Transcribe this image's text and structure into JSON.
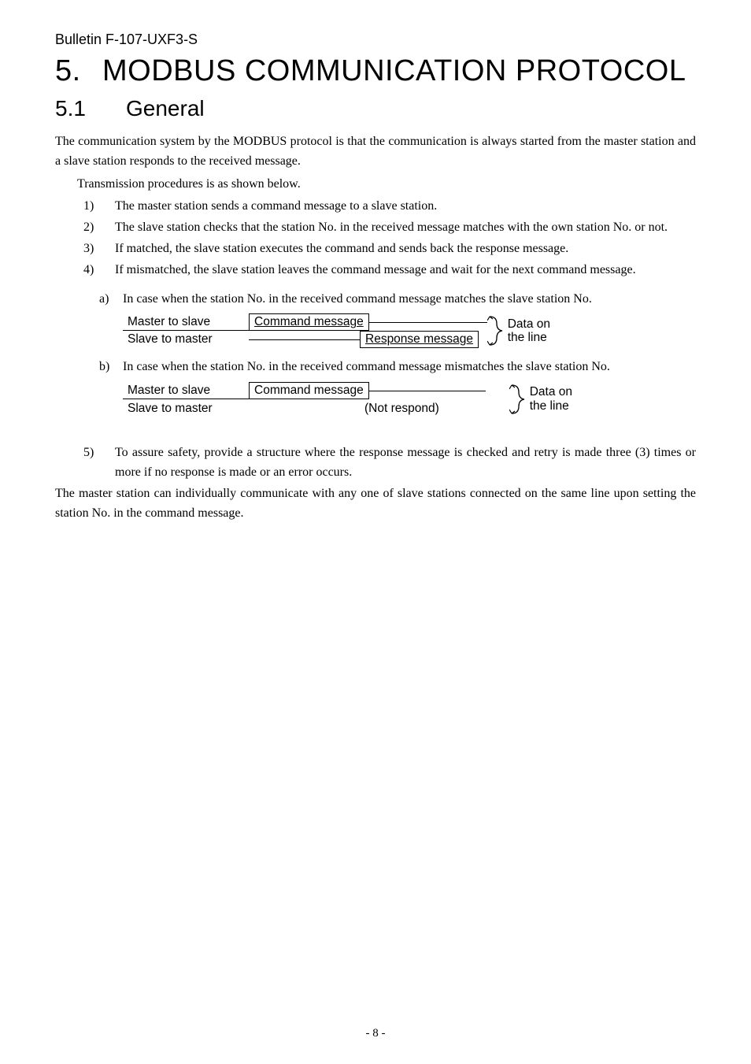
{
  "header": "Bulletin F-107-UXF3-S",
  "h1_num": "5.",
  "h1_text": "MODBUS COMMUNICATION PROTOCOL",
  "h2_num": "5.1",
  "h2_text": "General",
  "para1": "The communication system by the MODBUS protocol is that the communication is always started from the master station and a slave station responds to the received message.",
  "para2": "Transmission procedures is as shown below.",
  "list": {
    "n1": "1)",
    "t1": "The master station sends a command message to a slave station.",
    "n2": "2)",
    "t2": "The slave station checks that the station No. in the received message matches with the own station No. or not.",
    "n3": "3)",
    "t3": "If matched, the slave station executes the command and sends back the response message.",
    "n4": "4)",
    "t4": "If mismatched, the slave station leaves the command message and wait  for the next command message.",
    "n5": "5)",
    "t5": "To assure safety, provide a structure where the response message is checked and retry is made three (3) times or more if no response is made or an error occurs."
  },
  "sub": {
    "a_lbl": "a)",
    "a_text": "In case when the station No. in the received command message matches the slave station No.",
    "b_lbl": "b)",
    "b_text": "In case when the station No. in the received command message mismatches the slave station No."
  },
  "diagram": {
    "master_to_slave": "Master to slave",
    "slave_to_master": "Slave to master",
    "command_message": "Command message",
    "response_message": "Response message",
    "not_respond": "(Not respond)",
    "data_on": "Data on",
    "the_line": "the line"
  },
  "para3": "The master station can individually communicate with any one of slave stations connected on the same line upon setting the station No. in the command message.",
  "pagenum": "- 8 -"
}
